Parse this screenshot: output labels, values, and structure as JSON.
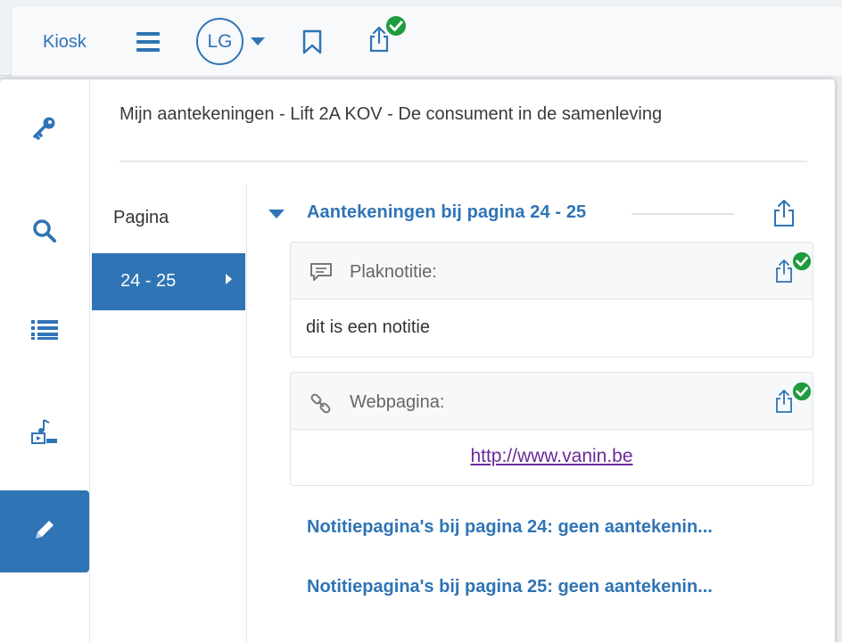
{
  "topbar": {
    "kiosk_label": "Kiosk",
    "avatar_initials": "LG",
    "icons": [
      "menu-icon",
      "chevron-down-icon",
      "bookmark-icon",
      "share-icon",
      "check-circle-icon"
    ]
  },
  "sidebar": {
    "items": [
      {
        "name": "key-icon"
      },
      {
        "name": "search-icon"
      },
      {
        "name": "list-icon"
      },
      {
        "name": "media-icon"
      },
      {
        "name": "pencil-icon",
        "active": true
      }
    ]
  },
  "panel": {
    "title": "Mijn aantekeningen - Lift 2A KOV - De consument in de samenleving",
    "pagelist": {
      "header": "Pagina",
      "items": [
        {
          "label": "24 - 25",
          "active": true
        }
      ]
    },
    "section_title": "Aantekeningen bij pagina 24 - 25",
    "cards": [
      {
        "label": "Plaknotitie:",
        "icon": "comment-icon",
        "content": "dit is een notitie"
      },
      {
        "label": "Webpagina:",
        "icon": "link-icon",
        "link": "http://www.vanin.be"
      }
    ],
    "notepages": [
      "Notitiepagina's bij pagina 24: geen aantekenin...",
      "Notitiepagina's bij pagina 25: geen aantekenin..."
    ]
  },
  "colors": {
    "accent": "#2f74b5",
    "check": "#1e9b3c",
    "link": "#6a2b9b"
  }
}
